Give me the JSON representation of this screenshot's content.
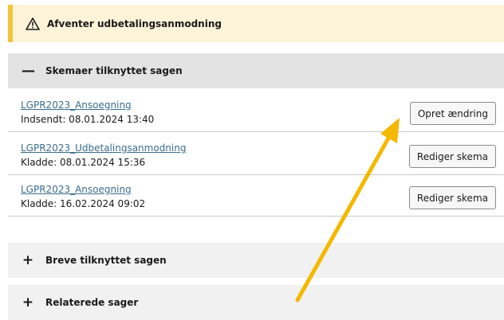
{
  "status": {
    "text": "Afventer udbetalingsanmodning",
    "icon": "warning-triangle-icon",
    "accent_color": "#f5c33a"
  },
  "sections": {
    "forms": {
      "toggle": "—",
      "title": "Skemaer tilknyttet sagen"
    },
    "letters": {
      "toggle": "+",
      "title": "Breve tilknyttet sagen"
    },
    "related": {
      "toggle": "+",
      "title": "Relaterede sager"
    }
  },
  "forms": [
    {
      "name": "LGPR2023_Ansoegning",
      "meta": "Indsendt: 08.01.2024 13:40",
      "button": "Opret ændring"
    },
    {
      "name": "LGPR2023_Udbetalingsanmodning",
      "meta": "Kladde: 08.01.2024 15:36",
      "button": "Rediger skema"
    },
    {
      "name": "LGPR2023_Ansoegning",
      "meta": "Kladde: 16.02.2024 09:02",
      "button": "Rediger skema"
    }
  ],
  "annotation": {
    "color": "#f5b800",
    "icon": "annotation-arrow"
  }
}
